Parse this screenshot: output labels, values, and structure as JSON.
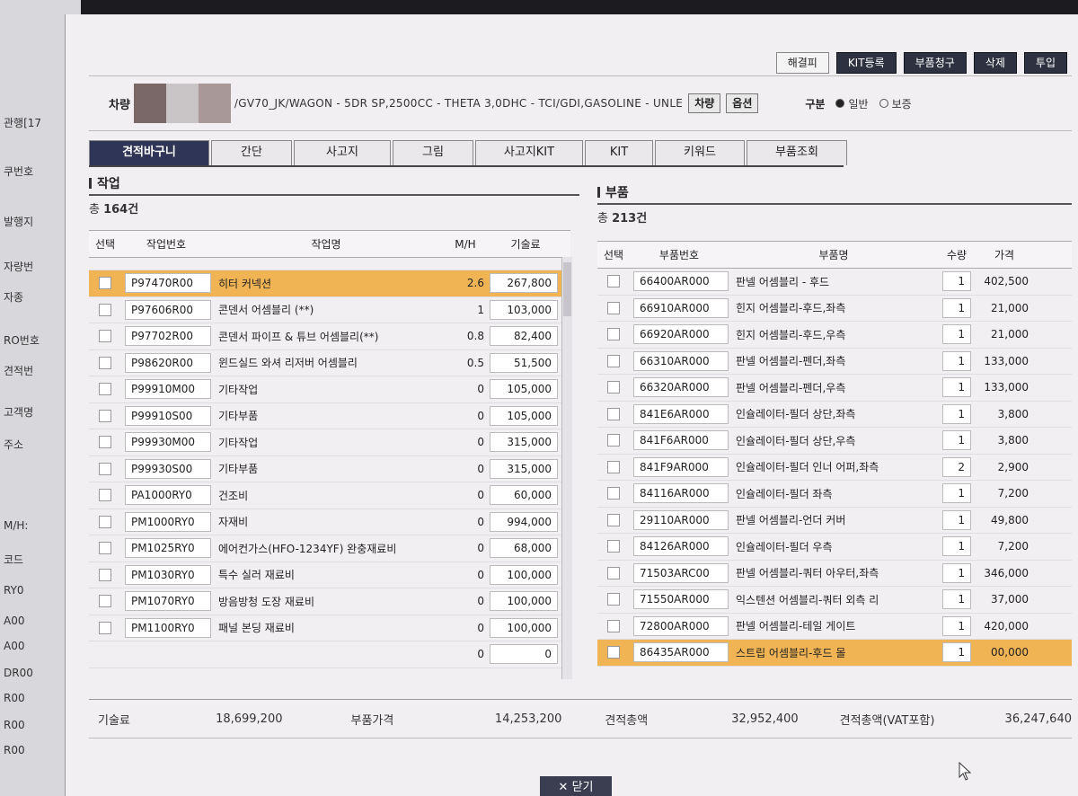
{
  "background": {
    "labels": [
      "관행[17",
      "쿠번호",
      "발행지",
      "자량번",
      "자종",
      "RO번호",
      "견적번",
      "고객명",
      "주소",
      "M/H:",
      "코드",
      "RY0",
      "A00",
      "A00",
      "DR00",
      "R00",
      "R00",
      "R00"
    ]
  },
  "toolbar": {
    "buttons": [
      "해결피",
      "KIT등록",
      "부품청구",
      "삭제",
      "투입"
    ]
  },
  "vehicle": {
    "label": "차량",
    "value": "/GV70_JK/WAGON - 5DR SP,2500CC - THETA 3,0DHC - TCI/GDI,GASOLINE - UNLE",
    "btn_vehicle": "차량",
    "btn_option": "옵션",
    "gubun_label": "구분",
    "radio_normal": "일반",
    "radio_insurance": "보증"
  },
  "tabs": [
    "견적바구니",
    "간단",
    "사고지",
    "그림",
    "사고지KIT",
    "KIT",
    "키워드",
    "부품조회"
  ],
  "work": {
    "title": "작업",
    "count_prefix": "총 ",
    "count_value": "164건",
    "headers": [
      "선택",
      "작업번호",
      "작업명",
      "M/H",
      "기술료"
    ],
    "rows": [
      {
        "code": "P97470R00",
        "name": "히터 커넥션",
        "mh": "2.6",
        "fee": "267,800",
        "highlight": true
      },
      {
        "code": "P97606R00",
        "name": "콘덴서 어셈블리 (**)",
        "mh": "1",
        "fee": "103,000"
      },
      {
        "code": "P97702R00",
        "name": "콘덴서 파이프 & 튜브 어셈블리(**)",
        "mh": "0.8",
        "fee": "82,400"
      },
      {
        "code": "P98620R00",
        "name": "윈드실드 와셔 리저버 어셈블리",
        "mh": "0.5",
        "fee": "51,500"
      },
      {
        "code": "P99910M00",
        "name": "기타작업",
        "mh": "0",
        "fee": "105,000"
      },
      {
        "code": "P99910S00",
        "name": "기타부품",
        "mh": "0",
        "fee": "105,000"
      },
      {
        "code": "P99930M00",
        "name": "기타작업",
        "mh": "0",
        "fee": "315,000"
      },
      {
        "code": "P99930S00",
        "name": "기타부품",
        "mh": "0",
        "fee": "315,000"
      },
      {
        "code": "PA1000RY0",
        "name": "건조비",
        "mh": "0",
        "fee": "60,000"
      },
      {
        "code": "PM1000RY0",
        "name": "자재비",
        "mh": "0",
        "fee": "994,000"
      },
      {
        "code": "PM1025RY0",
        "name": "에어컨가스(HFO-1234YF) 완충재료비",
        "mh": "0",
        "fee": "68,000"
      },
      {
        "code": "PM1030RY0",
        "name": "특수 실러 재료비",
        "mh": "0",
        "fee": "100,000"
      },
      {
        "code": "PM1070RY0",
        "name": "방음방청 도장 재료비",
        "mh": "0",
        "fee": "100,000"
      },
      {
        "code": "PM1100RY0",
        "name": "패널 본딩 재료비",
        "mh": "0",
        "fee": "100,000"
      },
      {
        "code": "",
        "name": "",
        "mh": "0",
        "fee": "0"
      }
    ]
  },
  "parts": {
    "title": "부품",
    "count_prefix": "총 ",
    "count_value": "213건",
    "headers": [
      "선택",
      "부품번호",
      "부품명",
      "수량",
      "가격"
    ],
    "rows": [
      {
        "code": "66400AR000",
        "name": "판넬 어셈블리 - 후드",
        "qty": "1",
        "price": "402,500"
      },
      {
        "code": "66910AR000",
        "name": "힌지 어셈블리-후드,좌측",
        "qty": "1",
        "price": "21,000"
      },
      {
        "code": "66920AR000",
        "name": "힌지 어셈블리-후드,우측",
        "qty": "1",
        "price": "21,000"
      },
      {
        "code": "66310AR000",
        "name": "판넬 어셈블리-펜더,좌측",
        "qty": "1",
        "price": "133,000"
      },
      {
        "code": "66320AR000",
        "name": "판넬 어셈블리-펜더,우측",
        "qty": "1",
        "price": "133,000"
      },
      {
        "code": "841E6AR000",
        "name": "인슐레이터-필더 상단,좌측",
        "qty": "1",
        "price": "3,800"
      },
      {
        "code": "841F6AR000",
        "name": "인슐레이터-필더 상단,우측",
        "qty": "1",
        "price": "3,800"
      },
      {
        "code": "841F9AR000",
        "name": "인슐레이터-필더 인너 어퍼,좌측",
        "qty": "2",
        "price": "2,900"
      },
      {
        "code": "84116AR000",
        "name": "인슐레이터-필더 좌측",
        "qty": "1",
        "price": "7,200"
      },
      {
        "code": "29110AR000",
        "name": "판넬 어셈블리-언더 커버",
        "qty": "1",
        "price": "49,800"
      },
      {
        "code": "84126AR000",
        "name": "인슐레이터-필더 우측",
        "qty": "1",
        "price": "7,200"
      },
      {
        "code": "71503ARC00",
        "name": "판넬 어셈블리-쿼터 아우터,좌측",
        "qty": "1",
        "price": "346,000"
      },
      {
        "code": "71550AR000",
        "name": "익스텐션 어셈블리-쿼터 외측 리",
        "qty": "1",
        "price": "37,000"
      },
      {
        "code": "72800AR000",
        "name": "판넬 어셈블리-테일 게이트",
        "qty": "1",
        "price": "420,000"
      },
      {
        "code": "86435AR000",
        "name": "스트립 어셈블리-후드 몰",
        "qty": "1",
        "price": "00,000",
        "highlight": true
      }
    ]
  },
  "totals": {
    "tech_label": "기술료",
    "tech_value": "18,699,200",
    "parts_label": "부품가격",
    "parts_value": "14,253,200",
    "total_label": "견적총액",
    "total_value": "32,952,400",
    "vat_label": "견적총액(VAT포함)",
    "vat_value": "36,247,640"
  },
  "close_label": "닫기",
  "colors": {
    "active_tab": "#2e3556",
    "highlight_row": "#f0b454",
    "dark_button": "#2e3140"
  }
}
